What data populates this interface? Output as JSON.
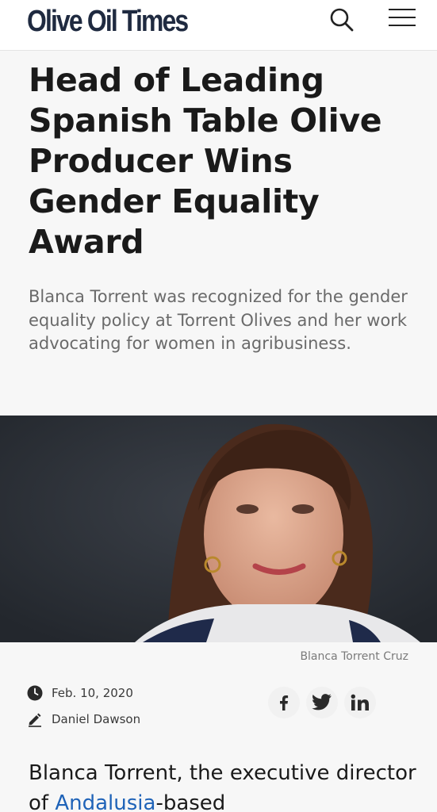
{
  "header": {
    "logo_text": "Olive Oil Times",
    "search_icon": "search-icon",
    "menu_icon": "hamburger-menu-icon"
  },
  "article": {
    "headline": "Head of Leading Spanish Table Olive Producer Wins Gender Equality Award",
    "subhead": "Blanca Torrent was recognized for the gender equality policy at Torrent Olives and her work advocating for women in agribusiness.",
    "image_caption": "Blanca Torrent Cruz",
    "date": "Feb. 10, 2020",
    "author": "Daniel Dawson",
    "body_intro": "Blanca Torrent, the executive director of ",
    "body_link": "Andalusia",
    "body_after_link": "-based"
  },
  "share": {
    "icons": [
      "facebook-icon",
      "twitter-icon",
      "linkedin-icon"
    ]
  },
  "colors": {
    "logo": "#1f2a40",
    "link": "#1f63b8",
    "subhead": "#6a6a6a",
    "background": "#f7f7f7"
  }
}
